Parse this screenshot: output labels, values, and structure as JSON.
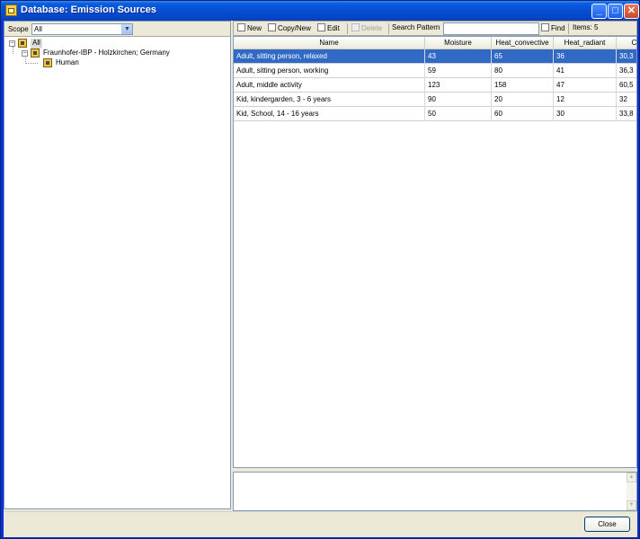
{
  "window": {
    "title": "Database: Emission Sources",
    "minimize_glyph": "_",
    "maximize_glyph": "□",
    "close_glyph": "✕"
  },
  "scope": {
    "label": "Scope",
    "selected": "All"
  },
  "tree": {
    "root": {
      "label": "All",
      "expanded": true,
      "icon": "database-icon"
    },
    "children": [
      {
        "label": "Fraunhofer-IBP - Holzkirchen; Germany",
        "expanded": true,
        "icon": "database-icon",
        "children": [
          {
            "label": "Human",
            "icon": "database-icon"
          }
        ]
      }
    ]
  },
  "toolbar": {
    "new_label": "New",
    "copy_new_label": "Copy/New",
    "edit_label": "Edit",
    "delete_label": "Delete",
    "search_label": "Search Pattern",
    "search_value": "",
    "find_label": "Find",
    "items_label": "Items: 5"
  },
  "grid": {
    "columns": [
      "Name",
      "Moisture",
      "Heat_convective",
      "Heat_radiant",
      "C"
    ],
    "rows": [
      {
        "cells": [
          "Adult, sitting person, relaxed",
          "43",
          "65",
          "36",
          "30,3"
        ],
        "selected": true
      },
      {
        "cells": [
          "Adult, sitting person, working",
          "59",
          "80",
          "41",
          "36,3"
        ],
        "selected": false
      },
      {
        "cells": [
          "Adult, middle activity",
          "123",
          "158",
          "47",
          "60,5"
        ],
        "selected": false
      },
      {
        "cells": [
          "Kid, kindergarden, 3 - 6 years",
          "90",
          "20",
          "12",
          "32"
        ],
        "selected": false
      },
      {
        "cells": [
          "Kid, School, 14 - 16 years",
          "50",
          "60",
          "30",
          "33,8"
        ],
        "selected": false
      }
    ]
  },
  "footer": {
    "close_label": "Close"
  },
  "colors": {
    "selection": "#316ac5",
    "titlebar": "#0551d6"
  }
}
